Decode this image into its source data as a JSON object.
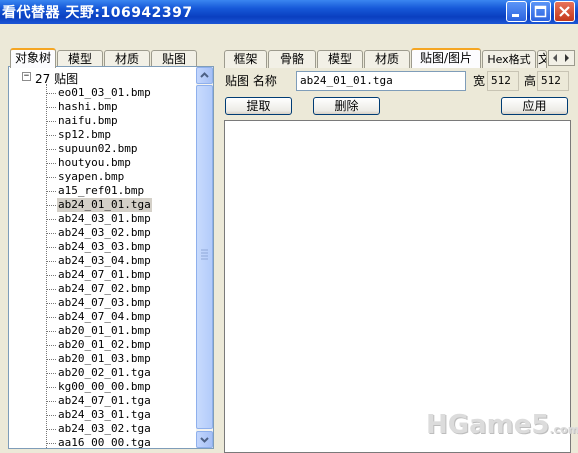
{
  "window": {
    "title": "看代替器  天野:106942397"
  },
  "left_tabs": [
    "对象树",
    "模型",
    "材质",
    "贴图"
  ],
  "left_active_tab": 0,
  "tree": {
    "root": {
      "toggle": "−",
      "label": "27 贴图"
    },
    "items": [
      "eo01_03_01.bmp",
      "hashi.bmp",
      "naifu.bmp",
      "sp12.bmp",
      "supuun02.bmp",
      "houtyou.bmp",
      "syapen.bmp",
      "a15_ref01.bmp",
      "ab24_01_01.tga",
      "ab24_03_01.bmp",
      "ab24_03_02.bmp",
      "ab24_03_03.bmp",
      "ab24_03_04.bmp",
      "ab24_07_01.bmp",
      "ab24_07_02.bmp",
      "ab24_07_03.bmp",
      "ab24_07_04.bmp",
      "ab20_01_01.bmp",
      "ab20_01_02.bmp",
      "ab20_01_03.bmp",
      "ab20_02_01.tga",
      "kg00_00_00.bmp",
      "ab24_07_01.tga",
      "ab24_03_01.tga",
      "ab24_03_02.tga",
      "aa16_00_00.tga"
    ],
    "selected_index": 8
  },
  "right_tabs": [
    "框架",
    "骨骼",
    "模型",
    "材质",
    "贴图/图片",
    "Hex格式",
    "文"
  ],
  "right_active_tab": 4,
  "texture_panel": {
    "name_label": "贴图 名称",
    "name_value": "ab24_01_01.tga",
    "width_label": "宽",
    "width_value": "512",
    "height_label": "高",
    "height_value": "512",
    "extract_button": "提取",
    "delete_button": "删除",
    "apply_button": "应用"
  },
  "watermark": {
    "main": "HGame5",
    "suffix": ".com"
  },
  "colors": {
    "titlebar": "#0a3fc0",
    "active_tab_accent": "#f5a623",
    "selection": "#d4d0c8",
    "window_face": "#ece9d8"
  }
}
